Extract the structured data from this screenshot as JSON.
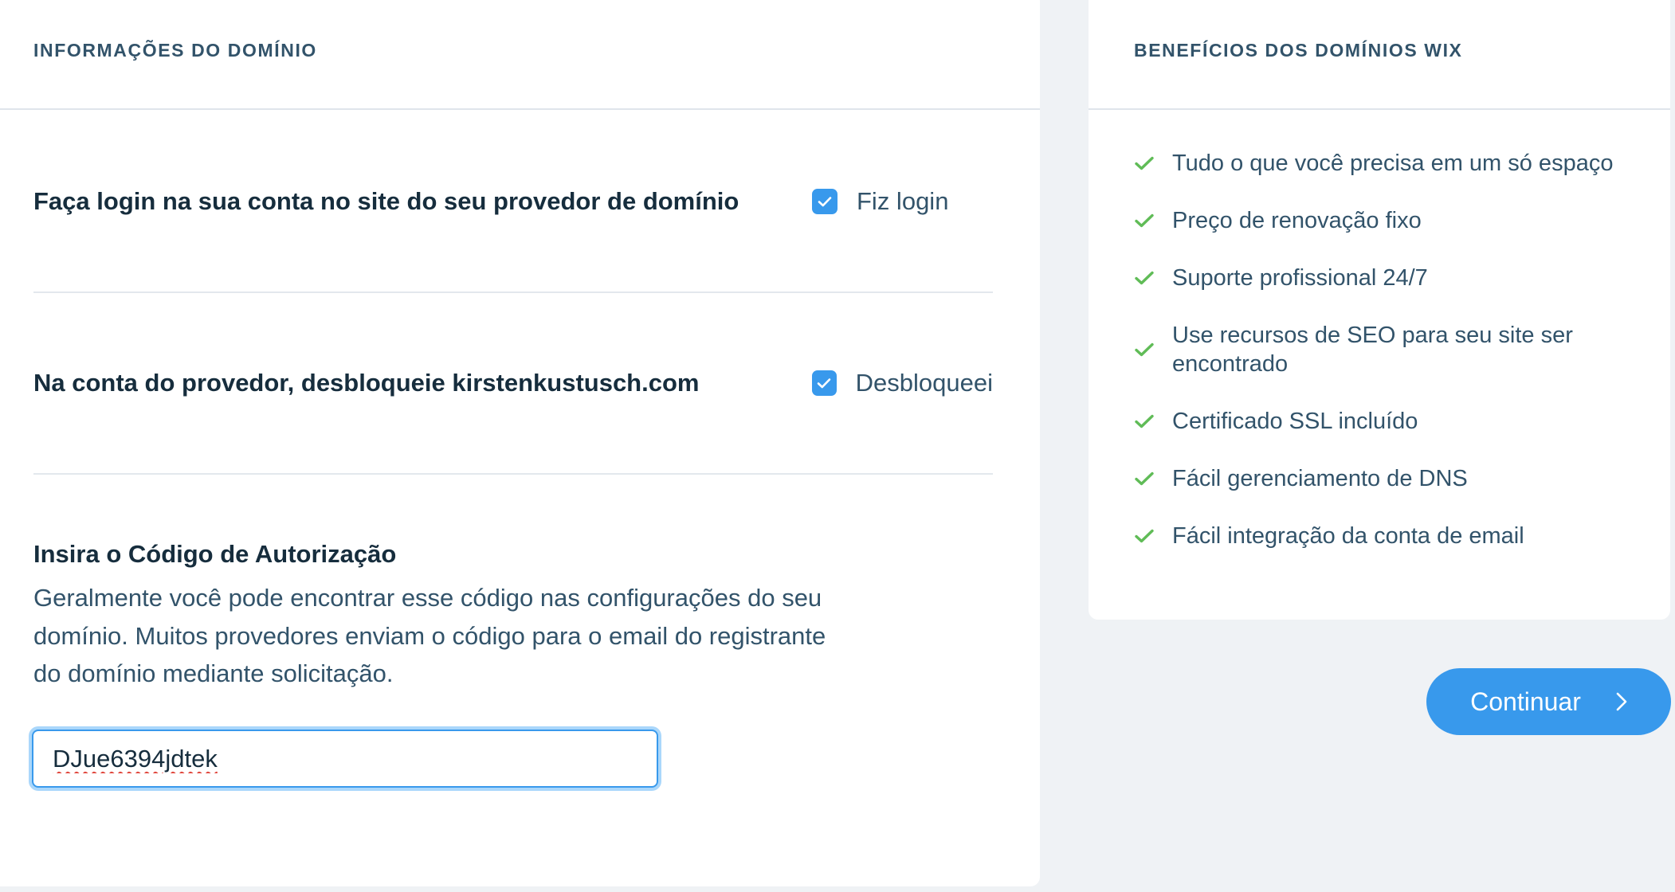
{
  "domain_info": {
    "header": "INFORMAÇÕES DO DOMÍNIO",
    "steps": [
      {
        "text": "Faça login na sua conta no site do seu provedor de domínio",
        "checkbox_label": "Fiz login",
        "checked": true
      },
      {
        "text": "Na conta do provedor, desbloqueie kirstenkustusch.com",
        "checkbox_label": "Desbloqueei",
        "checked": true
      }
    ],
    "auth": {
      "title": "Insira o Código de Autorização",
      "description": "Geralmente você pode encontrar esse código nas configurações do seu domínio. Muitos provedores enviam o código para o email do registrante do domínio mediante solicitação.",
      "code_value": "DJue6394jdtek"
    }
  },
  "benefits": {
    "header": "BENEFÍCIOS DOS DOMÍNIOS WIX",
    "items": [
      "Tudo o que você precisa em um só espaço",
      "Preço de renovação fixo",
      "Suporte profissional 24/7",
      "Use recursos de SEO para seu site ser encontrado",
      "Certificado SSL incluído",
      "Fácil gerenciamento de DNS",
      "Fácil integração da conta de email"
    ]
  },
  "continue_button": {
    "label": "Continuar"
  },
  "colors": {
    "accent": "#3899ec",
    "check_green": "#60bc57",
    "background": "#eff2f5",
    "text_dark": "#162d3d",
    "text_muted": "#32536a"
  },
  "icons": {
    "checkbox": "checkmark-icon",
    "benefit": "check-icon",
    "button": "chevron-right-icon"
  }
}
